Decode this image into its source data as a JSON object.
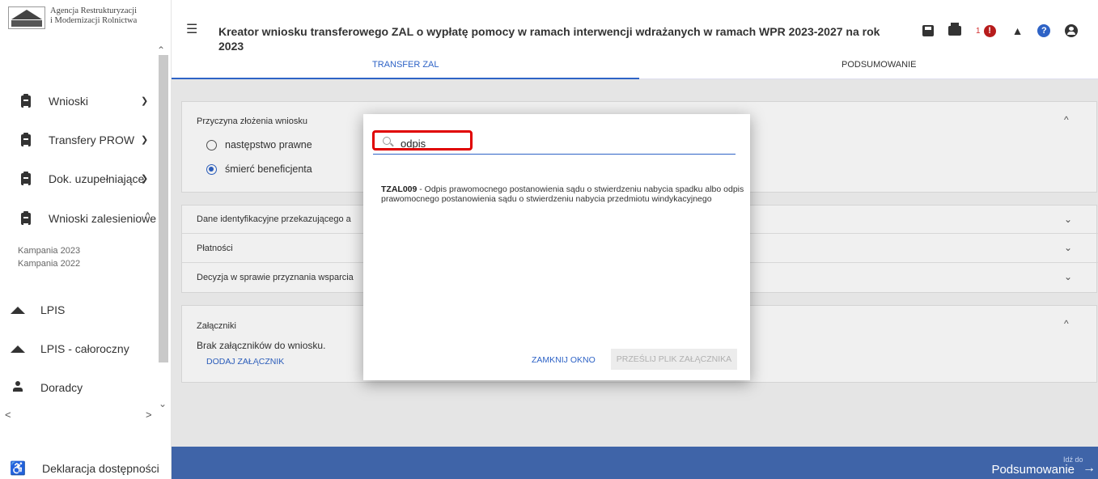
{
  "brand": {
    "line1": "Agencja Restrukturyzacji",
    "line2": "i Modernizacji Rolnictwa"
  },
  "header": {
    "title": "Kreator wniosku transferowego ZAL o wypłatę pomocy w ramach interwencji wdrażanych w ramach WPR 2023-2027 na rok 2023",
    "notification_count": "1",
    "icons": [
      "hamburger-icon",
      "save-icon",
      "print-icon",
      "alert-icon",
      "bell-icon",
      "help-icon",
      "user-icon"
    ]
  },
  "tabs": [
    {
      "label": "TRANSFER ZAL",
      "active": true
    },
    {
      "label": "PODSUMOWANIE",
      "active": false
    }
  ],
  "sidebar": {
    "items": [
      {
        "label": "Wnioski",
        "icon": "clipboard-icon",
        "chevron": "down"
      },
      {
        "label": "Transfery PROW",
        "icon": "clipboard-icon",
        "chevron": "down"
      },
      {
        "label": "Dok. uzupełniające",
        "icon": "clipboard-icon",
        "chevron": "down"
      },
      {
        "label": "Wnioski zalesieniowe",
        "icon": "clipboard-icon",
        "chevron": "up"
      },
      {
        "label": "LPIS",
        "icon": "mountain-icon"
      },
      {
        "label": "LPIS - całoroczny",
        "icon": "mountain-icon"
      },
      {
        "label": "Doradcy",
        "icon": "person-icon"
      }
    ],
    "subitems": [
      "Kampania 2023",
      "Kampania 2022"
    ],
    "accessibility": "Deklaracja dostępności"
  },
  "form": {
    "reason": {
      "heading": "Przyczyna złożenia wniosku",
      "options": [
        {
          "label": "następstwo prawne",
          "selected": false
        },
        {
          "label": "śmierć beneficjenta",
          "selected": true
        }
      ]
    },
    "sections": [
      "Dane identyfikacyjne przekazującego a",
      "Płatności",
      "Decyzja w sprawie przyznania wsparcia"
    ],
    "attachments": {
      "heading": "Załączniki",
      "empty_text": "Brak załączników do wniosku.",
      "add_link": "DODAJ ZAŁĄCZNIK"
    }
  },
  "modal": {
    "search_value": "odpis",
    "result_code": "TZAL009",
    "result_text": " - Odpis prawomocnego postanowienia sądu o stwierdzeniu nabycia spadku albo odpis prawomocnego postanowienia sądu o stwierdzeniu nabycia przedmiotu windykacyjnego",
    "close_label": "ZAMKNIJ OKNO",
    "upload_label": "PRZEŚLIJ PLIK ZAŁĄCZNIKA"
  },
  "footer": {
    "goto_small": "Idź do",
    "goto_target": "Podsumowanie"
  },
  "colors": {
    "accent": "#2e63c6",
    "footer": "#3f64a8",
    "highlight": "#e00000",
    "alert": "#b71c1c"
  }
}
